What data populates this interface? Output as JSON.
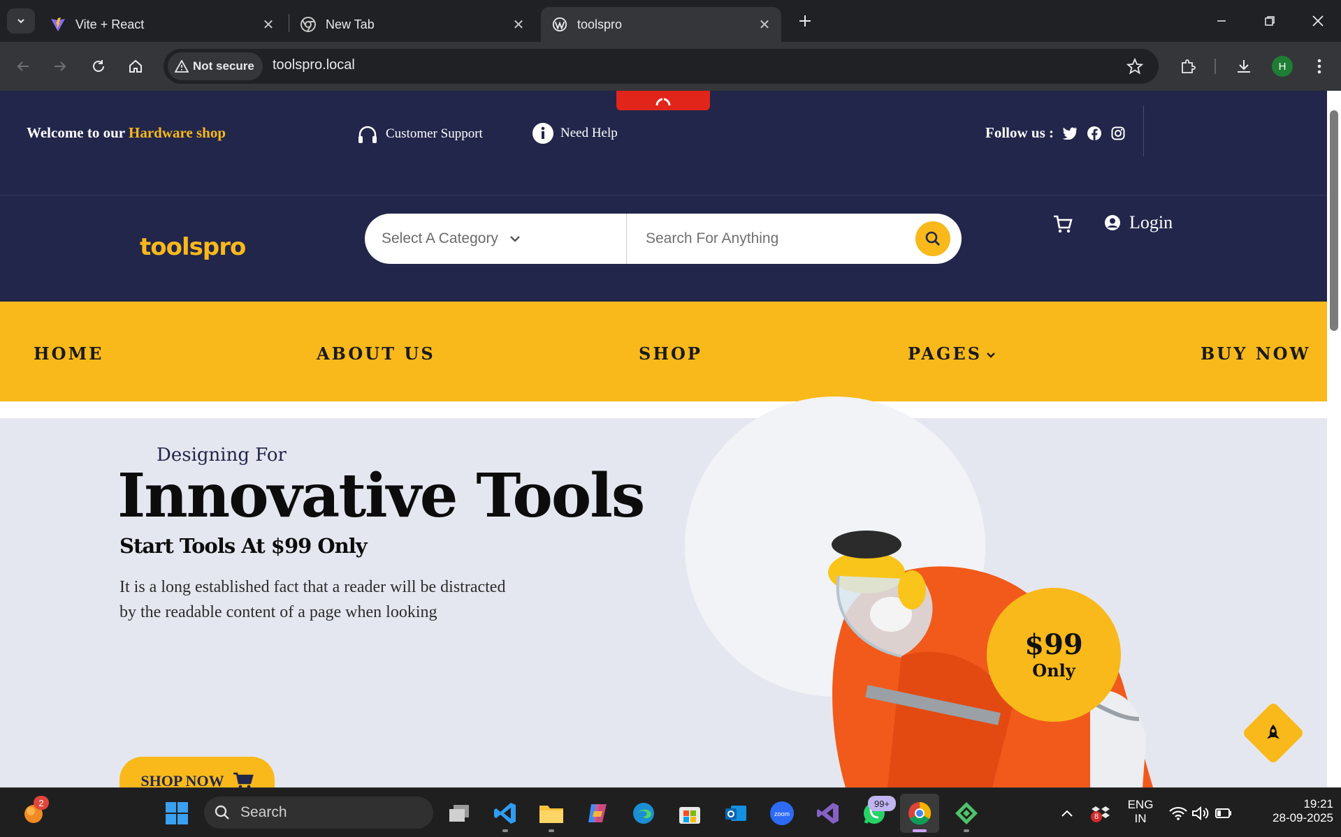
{
  "browser": {
    "tabs": [
      {
        "title": "Vite + React",
        "icon": "vite-icon"
      },
      {
        "title": "New Tab",
        "icon": "chrome-icon"
      },
      {
        "title": "toolspro",
        "icon": "wordpress-icon",
        "active": true
      }
    ],
    "security_label": "Not secure",
    "url": "toolspro.local",
    "profile_initial": "H"
  },
  "topbar": {
    "welcome_prefix": "Welcome to our",
    "welcome_accent": "Hardware shop",
    "support_label": "Customer Support",
    "help_label": "Need Help",
    "follow_label": "Follow us :"
  },
  "header": {
    "logo": "toolspro",
    "category_placeholder": "Select A Category",
    "search_placeholder": "Search For Anything",
    "login_label": "Login"
  },
  "nav": {
    "items": [
      "HOME",
      "ABOUT US",
      "SHOP",
      "PAGES",
      "BUY NOW"
    ]
  },
  "hero": {
    "kicker": "Designing For",
    "title": "Innovative Tools",
    "subtitle": "Start Tools At $99 Only",
    "description": "It is a long established fact that a reader will be distracted by the readable content of a page when looking",
    "cta": "SHOP NOW",
    "price_amount": "$99",
    "price_only": "Only"
  },
  "taskbar": {
    "search_label": "Search",
    "notification_count": "2",
    "whatsapp_badge": "99+",
    "tray_badge": "8",
    "lang_line1": "ENG",
    "lang_line2": "IN",
    "time": "19:21",
    "date": "28-09-2025"
  },
  "colors": {
    "navy": "#22264b",
    "accent": "#f9b91a",
    "hero_bg": "#e5e7f0"
  }
}
